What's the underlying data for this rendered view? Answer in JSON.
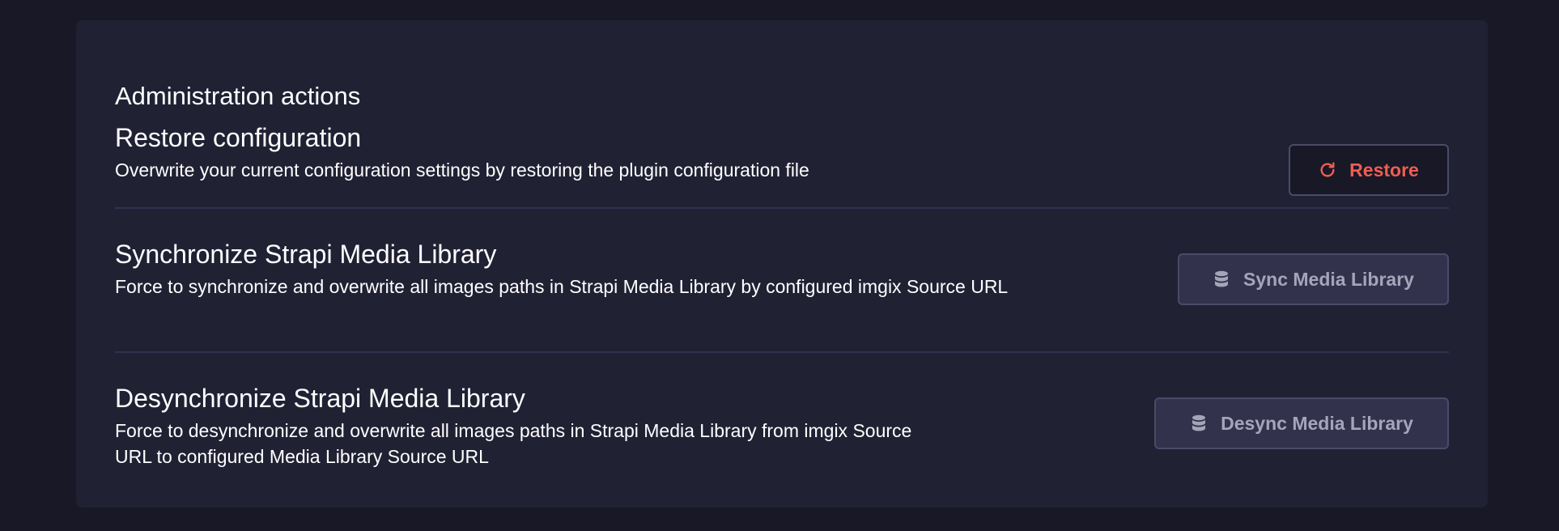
{
  "section": {
    "title": "Administration actions"
  },
  "actions": [
    {
      "title": "Restore configuration",
      "description": "Overwrite your current configuration settings by restoring the plugin configuration file",
      "button": {
        "label": "Restore",
        "icon": "refresh-icon",
        "state": "enabled",
        "color": "#ee5e52"
      }
    },
    {
      "title": "Synchronize Strapi Media Library",
      "description": "Force to synchronize and overwrite all images paths in Strapi Media Library by configured imgix Source URL",
      "button": {
        "label": "Sync Media Library",
        "icon": "database-icon",
        "state": "disabled",
        "color": "#a5a5ba"
      }
    },
    {
      "title": "Desynchronize Strapi Media Library",
      "description": "Force to desynchronize and overwrite all images paths in Strapi Media Library from imgix Source URL to configured Media Library Source URL",
      "button": {
        "label": "Desync Media Library",
        "icon": "database-icon",
        "state": "disabled",
        "color": "#a5a5ba"
      }
    }
  ]
}
